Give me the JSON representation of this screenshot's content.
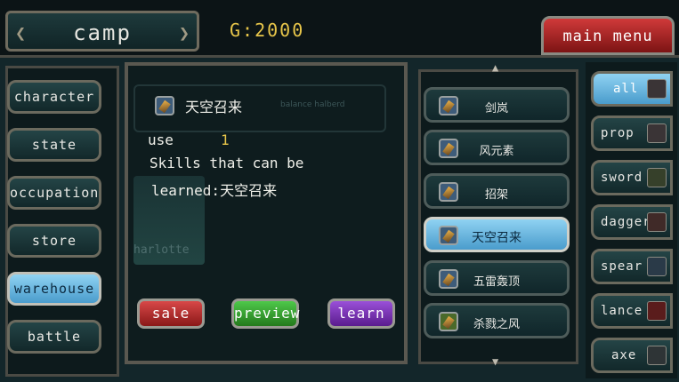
{
  "header": {
    "camp_title": "camp",
    "gold": "G:2000",
    "main_menu": "main menu"
  },
  "nav": [
    {
      "label": "character"
    },
    {
      "label": "state"
    },
    {
      "label": "occupation"
    },
    {
      "label": "store"
    },
    {
      "label": "warehouse"
    },
    {
      "label": "battle"
    }
  ],
  "detail": {
    "item_name": "天空召来",
    "use_label": "use",
    "use_value": "1",
    "desc_line1": "Skills that can be",
    "desc_line2": "learned:天空召来",
    "ghost_item": "balance halberd",
    "ghost_name": "harlotte"
  },
  "actions": {
    "sale": "sale",
    "preview": "preview",
    "learn": "learn"
  },
  "skills": [
    {
      "name": "剑岚"
    },
    {
      "name": "风元素"
    },
    {
      "name": "招架"
    },
    {
      "name": "天空召来"
    },
    {
      "name": "五雷轰顶"
    },
    {
      "name": "杀戮之风"
    }
  ],
  "filters": [
    {
      "label": "all"
    },
    {
      "label": "prop"
    },
    {
      "label": "sword"
    },
    {
      "label": "dagger"
    },
    {
      "label": "spear"
    },
    {
      "label": "lance"
    },
    {
      "label": "axe"
    }
  ],
  "selected": {
    "nav": "warehouse",
    "skill": "天空召来",
    "filter": "all"
  },
  "colors": {
    "gold": "#e8c64a",
    "selected_blue": "#6ab8e2",
    "sale": "#b02828",
    "preview": "#3aa032",
    "learn": "#7a38b8",
    "main_menu": "#b02020"
  },
  "icons": [
    "skill-scroll-icon",
    "prop-icon",
    "sword-icon",
    "dagger-icon",
    "spear-icon",
    "lance-icon",
    "axe-icon"
  ]
}
